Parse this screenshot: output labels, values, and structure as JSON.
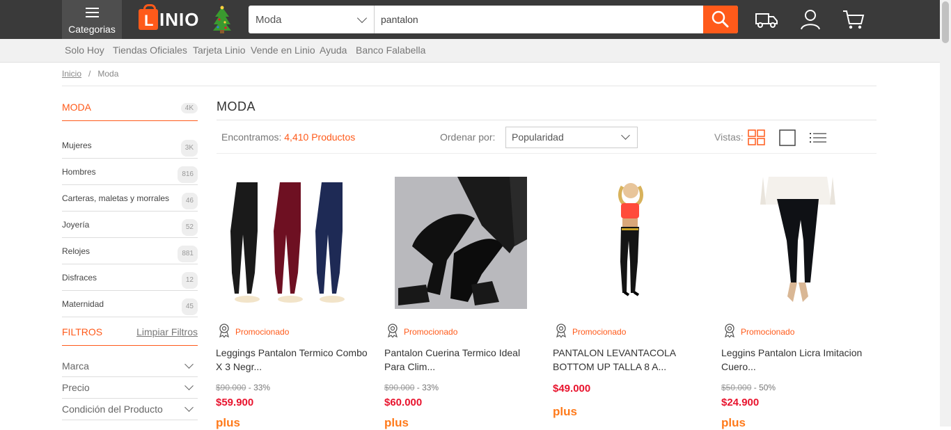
{
  "header": {
    "categories_label": "Categorias",
    "logo_text": "LINIO",
    "search": {
      "department": "Moda",
      "query": "pantalon"
    }
  },
  "subnav": [
    "Solo Hoy",
    "Tiendas Oficiales",
    "Tarjeta Linio",
    "Vende en Linio",
    "Ayuda",
    "Banco Falabella"
  ],
  "breadcrumb": {
    "home": "Inicio",
    "sep": "/",
    "current": "Moda"
  },
  "sidebar": {
    "title": "MODA",
    "count": "4K",
    "items": [
      {
        "label": "Mujeres",
        "count": "3K"
      },
      {
        "label": "Hombres",
        "count": "816"
      },
      {
        "label": "Carteras, maletas y morrales",
        "count": "46"
      },
      {
        "label": "Joyería",
        "count": "52"
      },
      {
        "label": "Relojes",
        "count": "881"
      },
      {
        "label": "Disfraces",
        "count": "12"
      },
      {
        "label": "Maternidad",
        "count": "45"
      }
    ]
  },
  "filters": {
    "title": "FILTROS",
    "clear": "Limpiar Filtros",
    "rows": [
      "Marca",
      "Precio",
      "Condición del Producto"
    ]
  },
  "main": {
    "title": "MODA",
    "found_prefix": "Encontramos:",
    "found_count": "4,410 Productos",
    "order_label": "Ordenar por:",
    "order_value": "Popularidad",
    "views_label": "Vistas:"
  },
  "products": [
    {
      "promo": "Promocionado",
      "name": "Leggings Pantalon Termico Combo X 3 Negr...",
      "old_price": "$90.000",
      "discount": "- 33%",
      "price": "$59.900",
      "plus": "plus"
    },
    {
      "promo": "Promocionado",
      "name": "Pantalon Cuerina Termico Ideal Para Clim...",
      "old_price": "$90.000",
      "discount": "- 33%",
      "price": "$60.000",
      "plus": "plus"
    },
    {
      "promo": "Promocionado",
      "name": "PANTALON LEVANTACOLA BOTTOM UP TALLA 8 A...",
      "old_price": "",
      "discount": "",
      "price": "$49.000",
      "plus": "plus"
    },
    {
      "promo": "Promocionado",
      "name": "Leggins Pantalon Licra Imitacion Cuero...",
      "old_price": "$50.000",
      "discount": "- 50%",
      "price": "$24.900",
      "plus": "plus"
    }
  ],
  "colors": {
    "accent": "#ff5a1a",
    "price": "#e8142e",
    "topbar": "#3a3a3a"
  }
}
